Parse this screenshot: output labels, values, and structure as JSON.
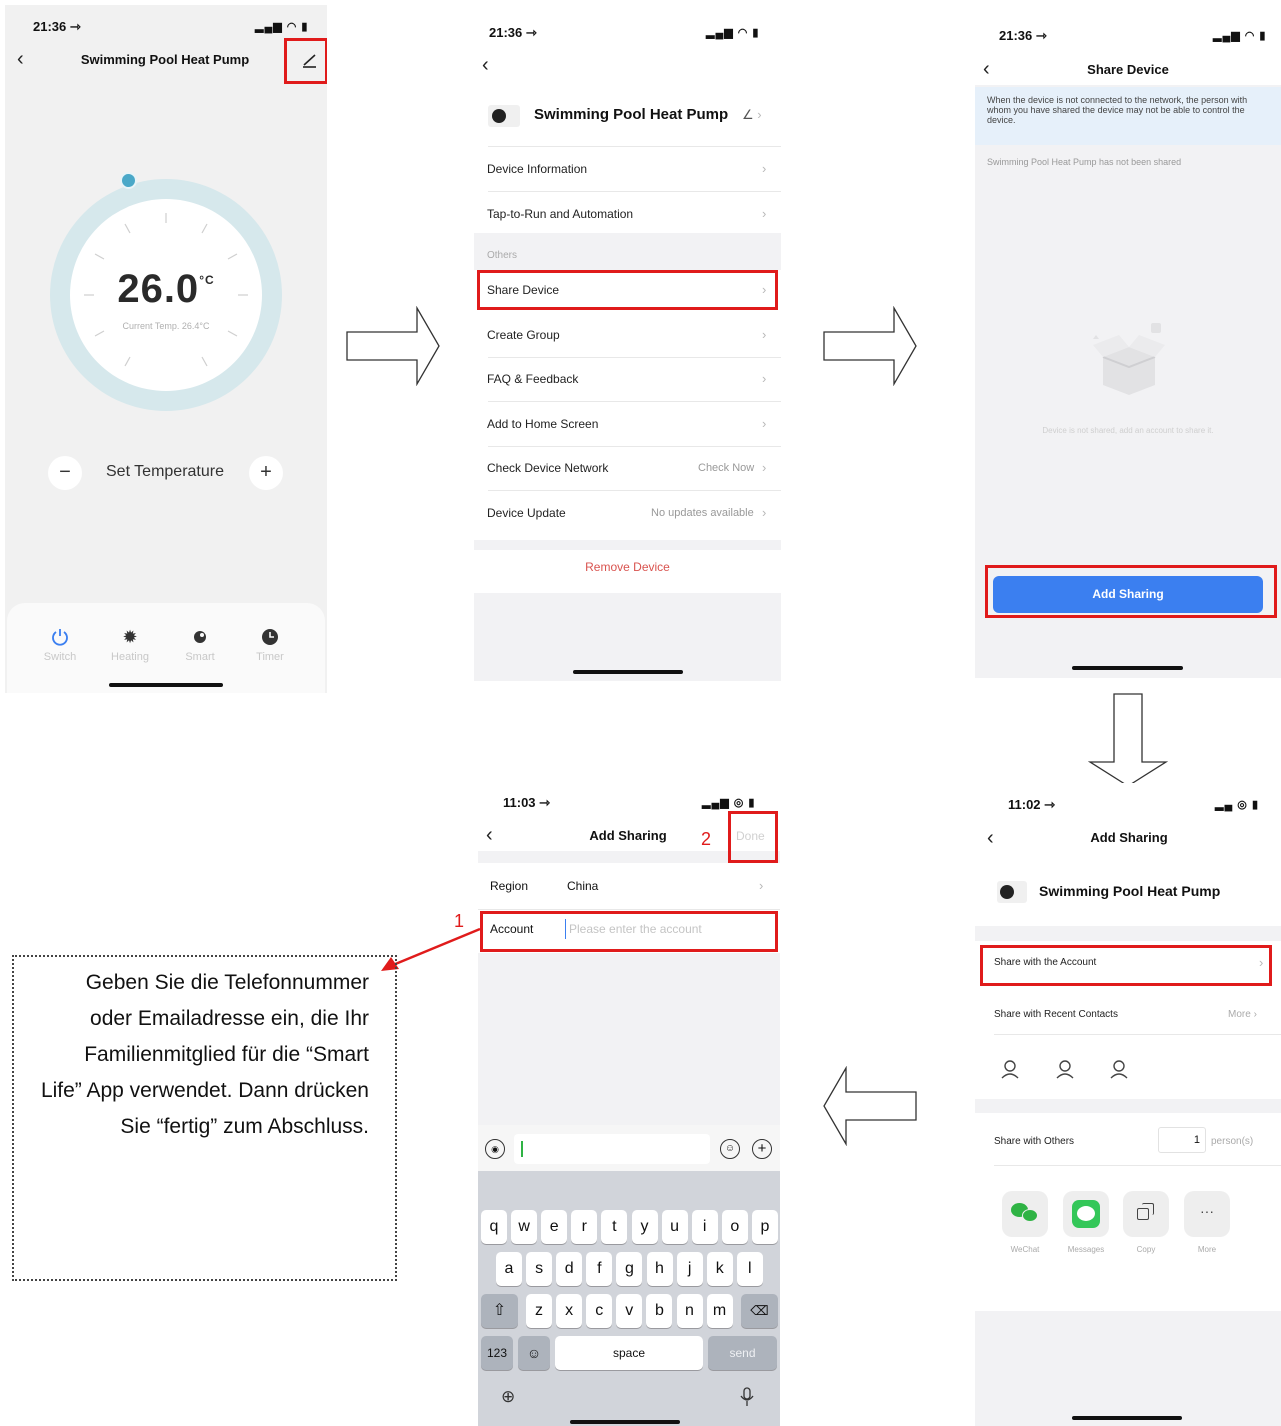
{
  "screen1": {
    "status_time": "21:36 ⇾",
    "title": "Swimming Pool Heat Pump",
    "temperature": "26.0",
    "temperature_unit": "°C",
    "current_temp": "Current Temp. 26.4°C",
    "set_temperature_label": "Set Temperature",
    "minus": "−",
    "plus": "+",
    "tabs": [
      {
        "label": "Switch",
        "icon": "power-icon"
      },
      {
        "label": "Heating",
        "icon": "sun-icon"
      },
      {
        "label": "Smart",
        "icon": "smart-icon"
      },
      {
        "label": "Timer",
        "icon": "clock-icon"
      }
    ],
    "accent_color": "#4aa8c8"
  },
  "screen2": {
    "status_time": "21:36 ⇾",
    "device_name": "Swimming Pool Heat Pump",
    "items": [
      {
        "label": "Device Information",
        "value": ""
      },
      {
        "label": "Tap-to-Run and Automation",
        "value": ""
      }
    ],
    "section_others": "Others",
    "others_items": [
      {
        "label": "Share Device",
        "value": ""
      },
      {
        "label": "Create Group",
        "value": ""
      },
      {
        "label": "FAQ & Feedback",
        "value": ""
      },
      {
        "label": "Add to Home Screen",
        "value": ""
      },
      {
        "label": "Check Device Network",
        "value": "Check Now"
      },
      {
        "label": "Device Update",
        "value": "No updates available"
      }
    ],
    "remove_label": "Remove Device",
    "remove_color": "#d9534f"
  },
  "screen3": {
    "status_time": "21:36 ⇾",
    "title": "Share Device",
    "notice": "When the device is not connected to the network, the person with whom you have shared the device may not be able to control the device.",
    "not_shared_text": "Swimming Pool Heat Pump has not been shared",
    "empty_state_text": "Device is not shared, add an account to share it.",
    "add_sharing_label": "Add Sharing",
    "button_color": "#3b7ff0"
  },
  "screen4": {
    "status_time": "11:02 ⇾",
    "title": "Add Sharing",
    "device_name": "Swimming Pool Heat Pump",
    "share_with_account": "Share with the Account",
    "share_recent": "Share with Recent Contacts",
    "more": "More",
    "share_others": "Share with Others",
    "person_count": "1",
    "person_unit": "person(s)",
    "apps": [
      {
        "label": "WeChat",
        "icon": "wechat-icon"
      },
      {
        "label": "Messages",
        "icon": "messages-icon"
      },
      {
        "label": "Copy",
        "icon": "copy-icon"
      },
      {
        "label": "More",
        "icon": "more-icon"
      }
    ]
  },
  "screen5": {
    "status_time": "11:03 ⇾",
    "title": "Add Sharing",
    "done_label": "Done",
    "region_label": "Region",
    "region_value": "China",
    "account_label": "Account",
    "account_placeholder": "Please enter the account",
    "marker1": "1",
    "marker2": "2",
    "keyboard": {
      "row1": [
        "q",
        "w",
        "e",
        "r",
        "t",
        "y",
        "u",
        "i",
        "o",
        "p"
      ],
      "row2": [
        "a",
        "s",
        "d",
        "f",
        "g",
        "h",
        "j",
        "k",
        "l"
      ],
      "row3": [
        "z",
        "x",
        "c",
        "v",
        "b",
        "n",
        "m"
      ],
      "numbers_key": "123",
      "space_key": "space",
      "send_key": "send"
    }
  },
  "instruction": "Geben Sie die Telefonnummer oder Emailadresse ein, die Ihr Familienmitglied für die “Smart Life” App verwendet. Dann drücken Sie “fertig” zum Abschluss.",
  "highlight_color": "#e01b1b"
}
